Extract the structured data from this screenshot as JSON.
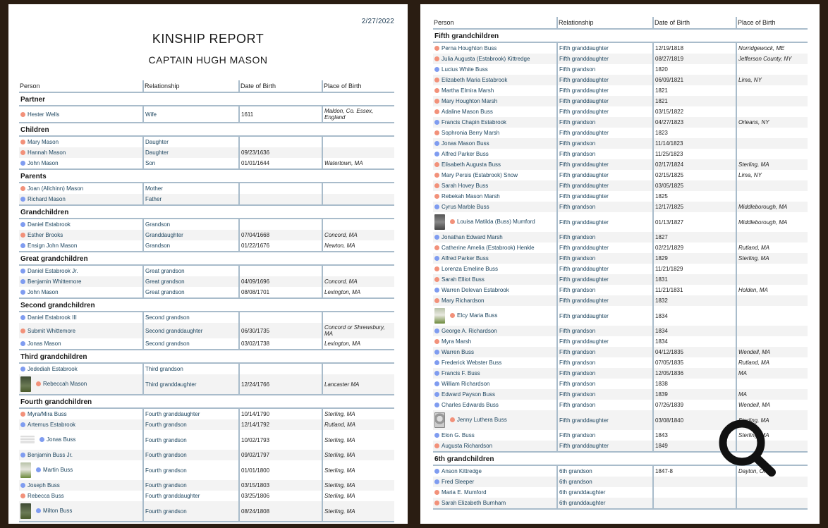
{
  "report": {
    "date": "2/27/2022",
    "title": "KINSHIP REPORT",
    "subject": "CAPTAIN HUGH MASON"
  },
  "colors": {
    "female": "#f2917a",
    "male": "#7f9cf0",
    "rule": "#a9bccb",
    "link": "#1e4660"
  },
  "columns": [
    "Person",
    "Relationship",
    "Date of Birth",
    "Place of Birth"
  ],
  "left_page": {
    "sections": [
      {
        "title": "Partner",
        "rows": [
          {
            "person": "Hester Wells",
            "sex": "female",
            "relationship": "Wife",
            "dob": "1611",
            "place": "Maldon, Co. Essex, England"
          }
        ]
      },
      {
        "title": "Children",
        "rows": [
          {
            "person": "Mary Mason",
            "sex": "female",
            "relationship": "Daughter",
            "dob": "",
            "place": ""
          },
          {
            "person": "Hannah Mason",
            "sex": "female",
            "relationship": "Daughter",
            "dob": "09/23/1636",
            "place": ""
          },
          {
            "person": "John Mason",
            "sex": "male",
            "relationship": "Son",
            "dob": "01/01/1644",
            "place": "Watertown, MA"
          }
        ]
      },
      {
        "title": "Parents",
        "rows": [
          {
            "person": "Joan (Allchinn) Mason",
            "sex": "female",
            "relationship": "Mother",
            "dob": "",
            "place": ""
          },
          {
            "person": "Richard Mason",
            "sex": "male",
            "relationship": "Father",
            "dob": "",
            "place": ""
          }
        ]
      },
      {
        "title": "Grandchildren",
        "rows": [
          {
            "person": "Daniel Estabrook",
            "sex": "male",
            "relationship": "Grandson",
            "dob": "",
            "place": ""
          },
          {
            "person": "Esther Brooks",
            "sex": "female",
            "relationship": "Granddaughter",
            "dob": "07/04/1668",
            "place": "Concord, MA"
          },
          {
            "person": "Ensign John Mason",
            "sex": "male",
            "relationship": "Grandson",
            "dob": "01/22/1676",
            "place": "Newton, MA"
          }
        ]
      },
      {
        "title": "Great grandchildren",
        "rows": [
          {
            "person": "Daniel Estabrook Jr.",
            "sex": "male",
            "relationship": "Great grandson",
            "dob": "",
            "place": ""
          },
          {
            "person": "Benjamin Whittemore",
            "sex": "male",
            "relationship": "Great grandson",
            "dob": "04/09/1696",
            "place": "Concord, MA"
          },
          {
            "person": "John Mason",
            "sex": "male",
            "relationship": "Great grandson",
            "dob": "08/08/1701",
            "place": "Lexington, MA"
          }
        ]
      },
      {
        "title": "Second grandchildren",
        "rows": [
          {
            "person": "Daniel Estabrook III",
            "sex": "male",
            "relationship": "Second grandson",
            "dob": "",
            "place": ""
          },
          {
            "person": "Submit Whittemore",
            "sex": "female",
            "relationship": "Second granddaughter",
            "dob": "06/30/1735",
            "place": "Concord or Shrewsbury, MA"
          },
          {
            "person": "Jonas Mason",
            "sex": "male",
            "relationship": "Second grandson",
            "dob": "03/02/1738",
            "place": "Lexington, MA"
          }
        ]
      },
      {
        "title": "Third grandchildren",
        "rows": [
          {
            "person": "Jedediah Estabrook",
            "sex": "male",
            "relationship": "Third grandson",
            "dob": "",
            "place": ""
          },
          {
            "person": "Rebeccah Mason",
            "sex": "female",
            "relationship": "Third granddaughter",
            "dob": "12/24/1766",
            "place": "Lancaster MA",
            "photo": "stone"
          }
        ]
      },
      {
        "title": "Fourth grandchildren",
        "rows": [
          {
            "person": "Myra/Mira Buss",
            "sex": "female",
            "relationship": "Fourth granddaughter",
            "dob": "10/14/1790",
            "place": "Sterling, MA"
          },
          {
            "person": "Artemus Estabrook",
            "sex": "male",
            "relationship": "Fourth grandson",
            "dob": "12/14/1792",
            "place": "Rutland, MA"
          },
          {
            "person": "Jonas Buss",
            "sex": "male",
            "relationship": "Fourth grandson",
            "dob": "10/02/1793",
            "place": "Sterling, MA",
            "photo": "doc"
          },
          {
            "person": "Benjamin Buss Jr.",
            "sex": "male",
            "relationship": "Fourth grandson",
            "dob": "09/02/1797",
            "place": "Sterling, MA"
          },
          {
            "person": "Martin Buss",
            "sex": "male",
            "relationship": "Fourth grandson",
            "dob": "01/01/1800",
            "place": "Sterling, MA",
            "photo": "white"
          },
          {
            "person": "Joseph Buss",
            "sex": "male",
            "relationship": "Fourth grandson",
            "dob": "03/15/1803",
            "place": "Sterling, MA"
          },
          {
            "person": "Rebecca Buss",
            "sex": "female",
            "relationship": "Fourth granddaughter",
            "dob": "03/25/1806",
            "place": "Sterling, MA"
          },
          {
            "person": "Milton Buss",
            "sex": "male",
            "relationship": "Fourth grandson",
            "dob": "08/24/1808",
            "place": "Sterling, MA",
            "photo": "stone"
          }
        ]
      }
    ]
  },
  "right_page": {
    "sections": [
      {
        "title": "Fifth grandchildren",
        "rows": [
          {
            "person": "Perna Houghton Buss",
            "sex": "female",
            "relationship": "Fifth granddaughter",
            "dob": "12/19/1818",
            "place": "Norridgewock, ME"
          },
          {
            "person": "Julia Augusta (Estabrook) Kittredge",
            "sex": "female",
            "relationship": "Fifth granddaughter",
            "dob": "08/27/1819",
            "place": "Jefferson County, NY"
          },
          {
            "person": "Lucius White Buss",
            "sex": "male",
            "relationship": "Fifth grandson",
            "dob": "1820",
            "place": ""
          },
          {
            "person": "Elizabeth Maria Estabrook",
            "sex": "female",
            "relationship": "Fifth granddaughter",
            "dob": "06/09/1821",
            "place": "Lima, NY"
          },
          {
            "person": "Martha Elmira Marsh",
            "sex": "female",
            "relationship": "Fifth granddaughter",
            "dob": "1821",
            "place": ""
          },
          {
            "person": "Mary Houghton Marsh",
            "sex": "female",
            "relationship": "Fifth granddaughter",
            "dob": "1821",
            "place": ""
          },
          {
            "person": "Adaline Mason Buss",
            "sex": "female",
            "relationship": "Fifth granddaughter",
            "dob": "03/15/1822",
            "place": ""
          },
          {
            "person": "Francis Chapin Estabrook",
            "sex": "male",
            "relationship": "Fifth grandson",
            "dob": "04/27/1823",
            "place": "Orleans, NY"
          },
          {
            "person": "Sophronia Berry Marsh",
            "sex": "female",
            "relationship": "Fifth granddaughter",
            "dob": "1823",
            "place": ""
          },
          {
            "person": "Jonas Mason Buss",
            "sex": "male",
            "relationship": "Fifth grandson",
            "dob": "11/14/1823",
            "place": ""
          },
          {
            "person": "Alfred Parker Buss",
            "sex": "male",
            "relationship": "Fifth grandson",
            "dob": "11/25/1823",
            "place": ""
          },
          {
            "person": "Elisabeth Augusta Buss",
            "sex": "female",
            "relationship": "Fifth granddaughter",
            "dob": "02/17/1824",
            "place": "Sterling, MA"
          },
          {
            "person": "Mary Persis (Estabrook) Snow",
            "sex": "female",
            "relationship": "Fifth granddaughter",
            "dob": "02/15/1825",
            "place": "Lima, NY"
          },
          {
            "person": "Sarah Hovey Buss",
            "sex": "female",
            "relationship": "Fifth granddaughter",
            "dob": "03/05/1825",
            "place": ""
          },
          {
            "person": "Rebekah Mason Marsh",
            "sex": "female",
            "relationship": "Fifth granddaughter",
            "dob": "1825",
            "place": ""
          },
          {
            "person": "Cyrus Marble Buss",
            "sex": "male",
            "relationship": "Fifth grandson",
            "dob": "12/17/1825",
            "place": "Middleborough, MA"
          },
          {
            "person": "Louisa Matilda (Buss) Mumford",
            "sex": "female",
            "relationship": "Fifth granddaughter",
            "dob": "01/13/1827",
            "place": "Middleborough, MA",
            "photo": "grey"
          },
          {
            "person": "Jonathan Edward Marsh",
            "sex": "male",
            "relationship": "Fifth grandson",
            "dob": "1827",
            "place": ""
          },
          {
            "person": "Catherine Amelia (Estabrook) Henkle",
            "sex": "female",
            "relationship": "Fifth granddaughter",
            "dob": "02/21/1829",
            "place": "Rutland, MA"
          },
          {
            "person": "Alfred Parker Buss",
            "sex": "male",
            "relationship": "Fifth grandson",
            "dob": "1829",
            "place": "Sterling, MA"
          },
          {
            "person": "Lorenza Emeline Buss",
            "sex": "female",
            "relationship": "Fifth granddaughter",
            "dob": "11/21/1829",
            "place": ""
          },
          {
            "person": "Sarah Elliot Buss",
            "sex": "female",
            "relationship": "Fifth granddaughter",
            "dob": "1831",
            "place": ""
          },
          {
            "person": "Warren Delevan Estabrook",
            "sex": "male",
            "relationship": "Fifth grandson",
            "dob": "11/21/1831",
            "place": "Holden, MA"
          },
          {
            "person": "Mary Richardson",
            "sex": "female",
            "relationship": "Fifth granddaughter",
            "dob": "1832",
            "place": ""
          },
          {
            "person": "Elcy Maria Buss",
            "sex": "female",
            "relationship": "Fifth granddaughter",
            "dob": "1834",
            "place": "",
            "photo": "white"
          },
          {
            "person": "George A. Richardson",
            "sex": "male",
            "relationship": "Fifth grandson",
            "dob": "1834",
            "place": ""
          },
          {
            "person": "Myra Marsh",
            "sex": "female",
            "relationship": "Fifth granddaughter",
            "dob": "1834",
            "place": ""
          },
          {
            "person": "Warren Buss",
            "sex": "male",
            "relationship": "Fifth grandson",
            "dob": "04/12/1835",
            "place": "Wendell, MA"
          },
          {
            "person": "Frederick Webster Buss",
            "sex": "male",
            "relationship": "Fifth grandson",
            "dob": "07/05/1835",
            "place": "Rutland, MA"
          },
          {
            "person": "Francis F. Buss",
            "sex": "male",
            "relationship": "Fifth grandson",
            "dob": "12/05/1836",
            "place": "MA"
          },
          {
            "person": "William Richardson",
            "sex": "male",
            "relationship": "Fifth grandson",
            "dob": "1838",
            "place": ""
          },
          {
            "person": "Edward Payson Buss",
            "sex": "male",
            "relationship": "Fifth grandson",
            "dob": "1839",
            "place": "MA"
          },
          {
            "person": "Charles Edwards Buss",
            "sex": "male",
            "relationship": "Fifth grandson",
            "dob": "07/26/1839",
            "place": "Wendell, MA"
          },
          {
            "person": "Jenny Luthera Buss",
            "sex": "female",
            "relationship": "Fifth granddaughter",
            "dob": "03/08/1840",
            "place": "Sterling, MA",
            "photo": "portrait"
          },
          {
            "person": "Elon G. Buss",
            "sex": "male",
            "relationship": "Fifth grandson",
            "dob": "1843",
            "place": "Sterling, MA"
          },
          {
            "person": "Augusta Richardson",
            "sex": "female",
            "relationship": "Fifth granddaughter",
            "dob": "1849",
            "place": ""
          }
        ]
      },
      {
        "title": "6th grandchildren",
        "rows": [
          {
            "person": "Anson Kittredge",
            "sex": "male",
            "relationship": "6th grandson",
            "dob": "1847-8",
            "place": "Dayton, OH"
          },
          {
            "person": "Fred Sleeper",
            "sex": "male",
            "relationship": "6th grandson",
            "dob": "",
            "place": ""
          },
          {
            "person": "Maria E. Mumford",
            "sex": "female",
            "relationship": "6th granddaughter",
            "dob": "",
            "place": ""
          },
          {
            "person": "Sarah Elizabeth Burnham",
            "sex": "female",
            "relationship": "6th granddaughter",
            "dob": "",
            "place": ""
          }
        ]
      }
    ]
  },
  "overlay": {
    "icon": "magnifier-icon"
  }
}
